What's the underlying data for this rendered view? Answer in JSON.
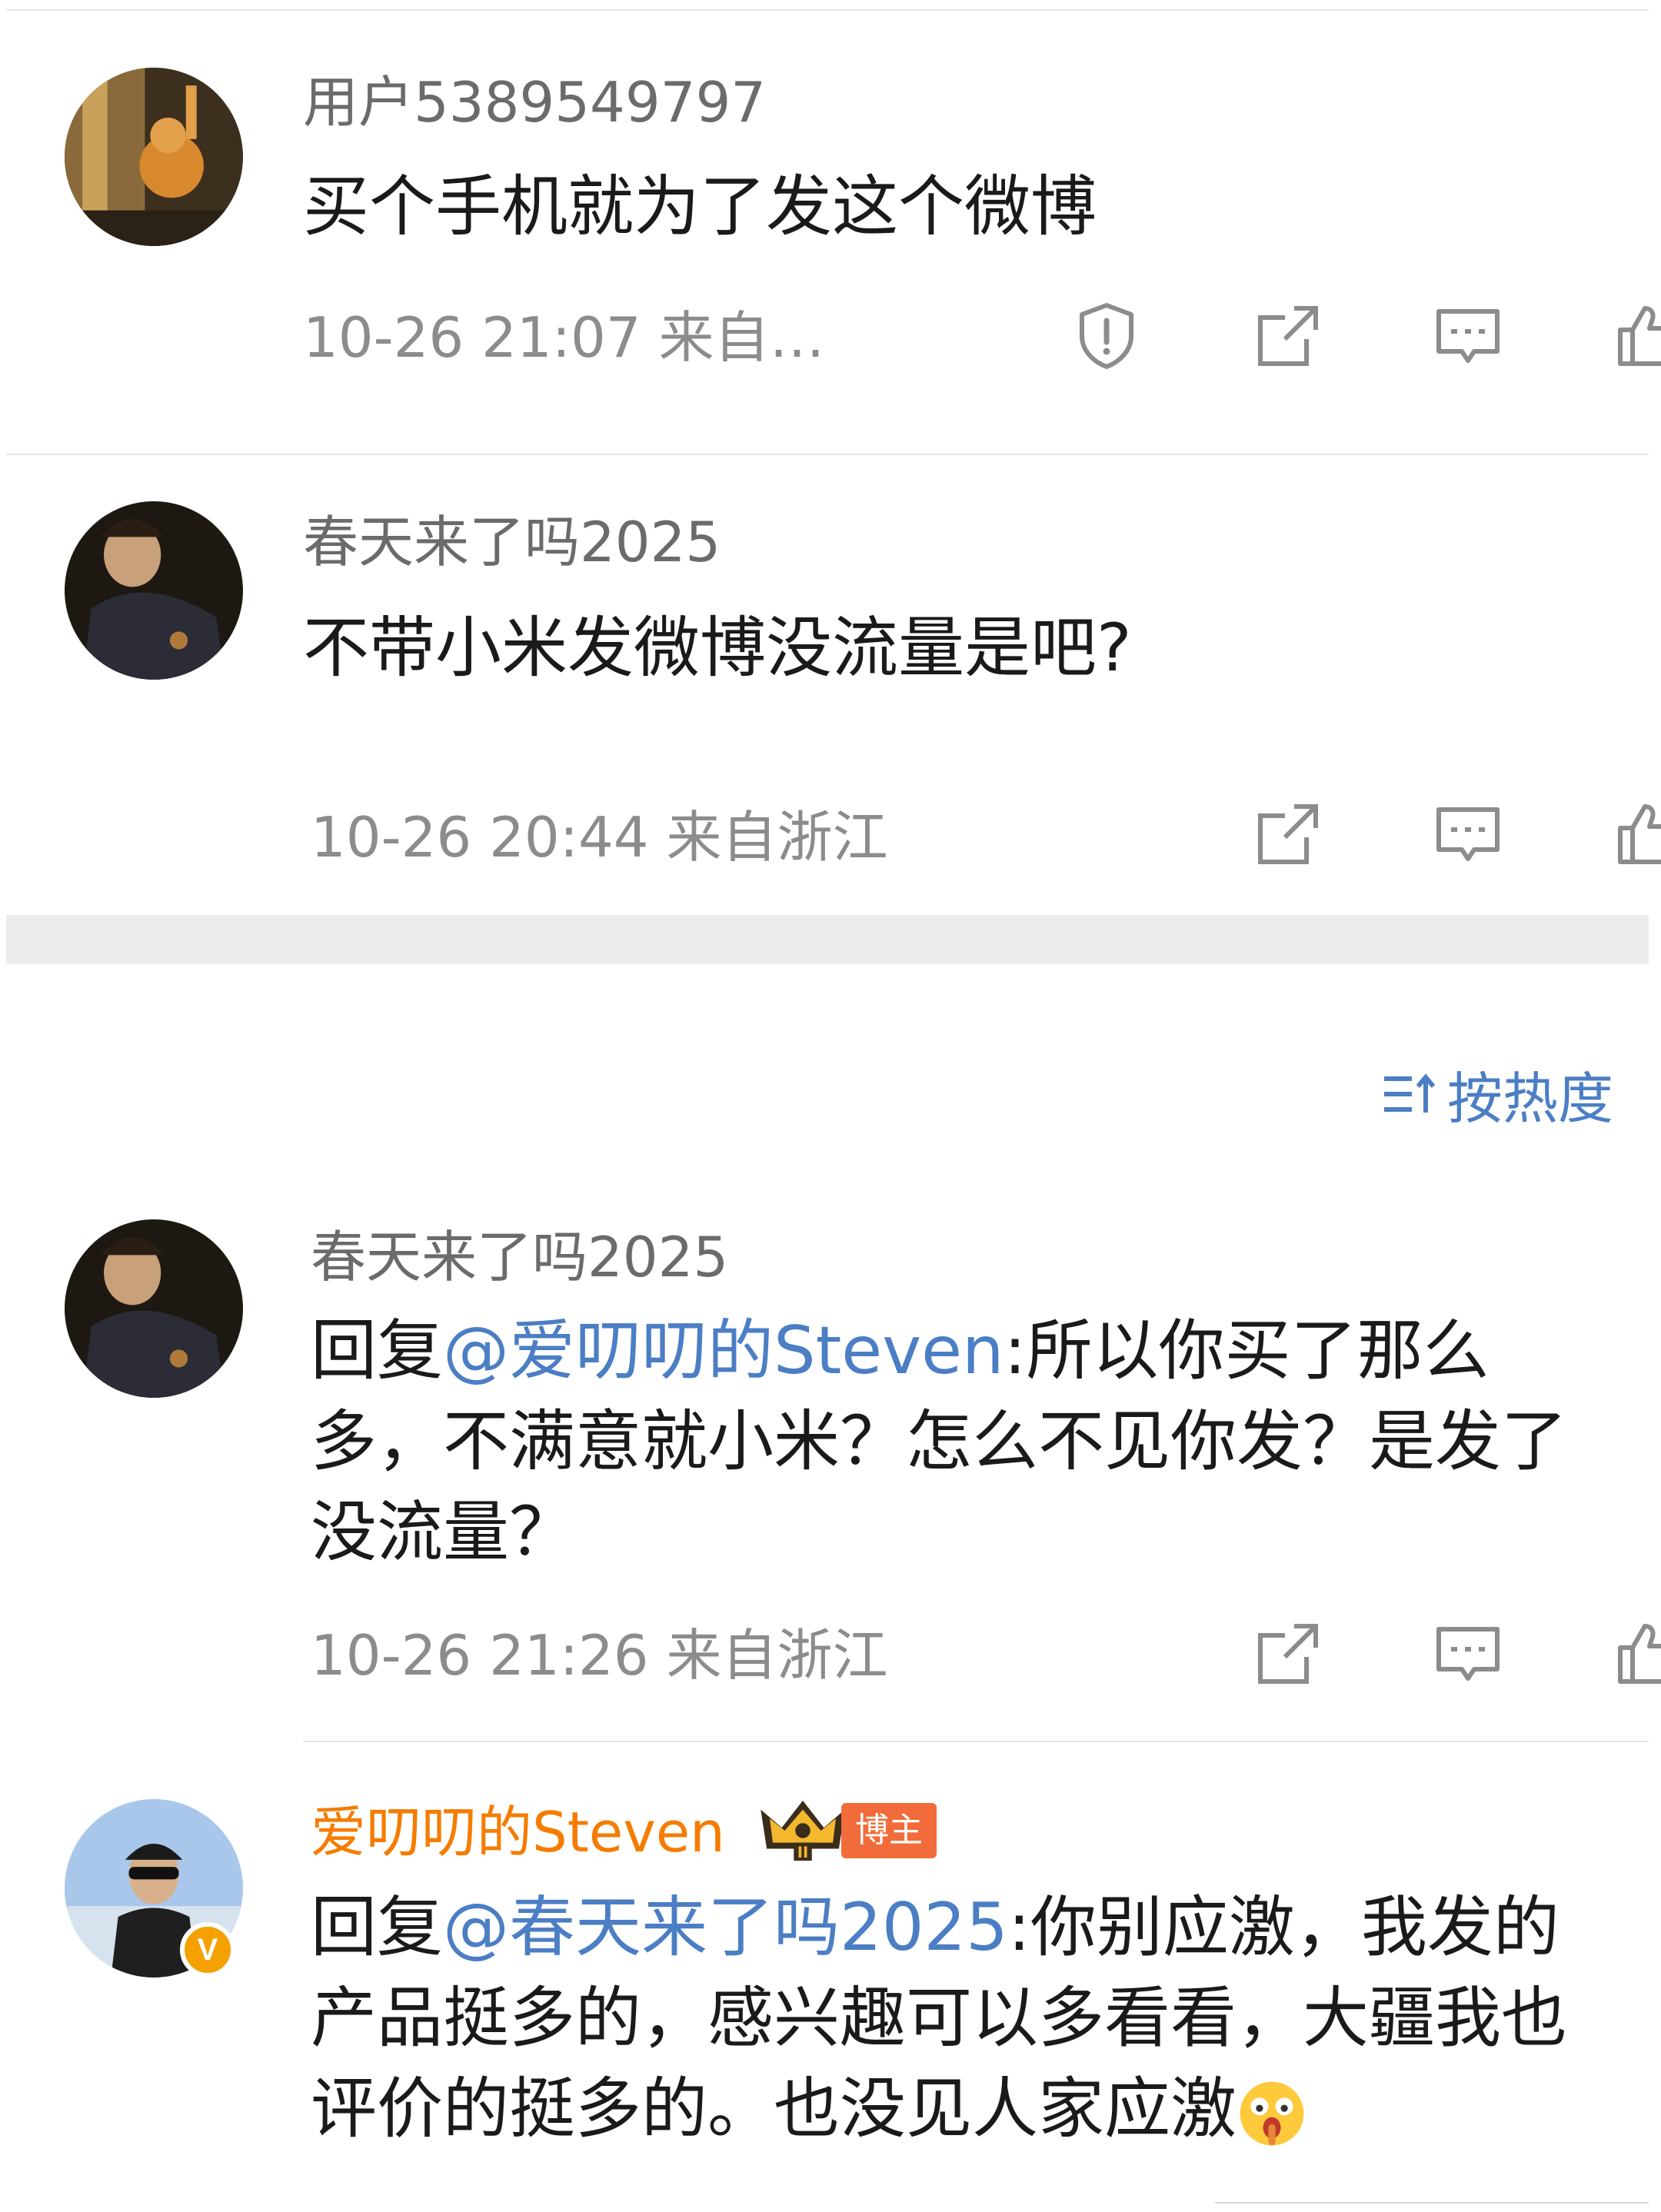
{
  "comments_top": [
    {
      "username": "用户5389549797",
      "text": "买个手机就为了发这个微博",
      "meta": "10-26 21:07 来自…",
      "show_report": true
    },
    {
      "username": "春天来了吗2025",
      "text": "不带小米发微博没流量是吧?",
      "meta": "10-26 20:44 来自浙江",
      "show_report": false
    }
  ],
  "sort": {
    "label": "按热度",
    "icon": "sort-icon"
  },
  "replies": [
    {
      "username": "春天来了吗2025",
      "reply_prefix": "回复",
      "mention": "@爱叨叨的Steven",
      "text": ":所以你买了那么多，不满意就小米？怎么不见你发？是发了没流量？",
      "meta": "10-26 21:26 来自浙江"
    },
    {
      "username": "爱叨叨的Steven",
      "badge_label": "博主",
      "badge_level": "II",
      "verified_mark": "V",
      "reply_prefix": "回复",
      "mention": "@春天来了吗2025",
      "text": ":你别应激，我发的产品挺多的，感兴趣可以多看看，大疆我也评价的挺多的。也没见人家应激",
      "emoji": "face-emoji"
    }
  ],
  "colors": {
    "mention": "#4b7ec4",
    "author_name": "#f57c00",
    "blogger_tag": "#f26b3a",
    "verified": "#f4a100"
  },
  "icons": [
    "report-icon",
    "share-icon",
    "comment-icon",
    "like-icon"
  ]
}
